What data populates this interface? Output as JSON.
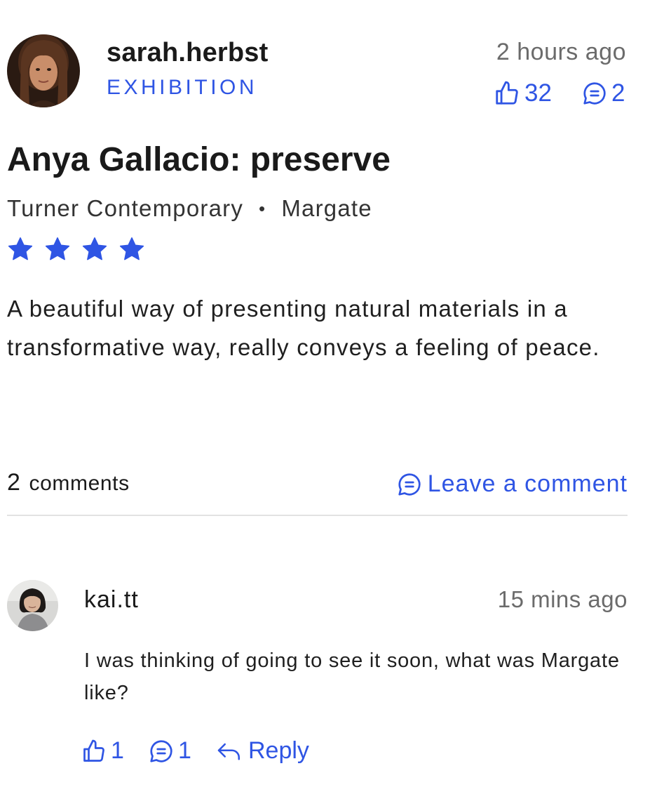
{
  "post": {
    "username": "sarah.herbst",
    "category": "EXHIBITION",
    "time": "2 hours ago",
    "likes": "32",
    "comments": "2",
    "title": "Anya Gallacio: preserve",
    "venue": "Turner Contemporary",
    "separator": "•",
    "location": "Margate",
    "rating": 4,
    "rating_max": 4,
    "review": "A beautiful way of presenting natural materials in a transformative way, really conveys a feeling of peace."
  },
  "comments_section": {
    "count": "2",
    "count_label": "comments",
    "leave_comment_label": "Leave a comment"
  },
  "comment": {
    "username": "kai.tt",
    "time": "15 mins ago",
    "text": "I was thinking of going to see it soon, what was Margate like?",
    "likes": "1",
    "replies": "1",
    "reply_label": "Reply"
  },
  "colors": {
    "accent": "#2f55e4",
    "muted_text": "#6b6b6b",
    "divider": "#e2e2e2"
  },
  "icons": {
    "like": "thumbs-up-icon",
    "comment": "speech-bubble-icon",
    "star": "star-icon",
    "reply": "reply-arrow-icon"
  }
}
